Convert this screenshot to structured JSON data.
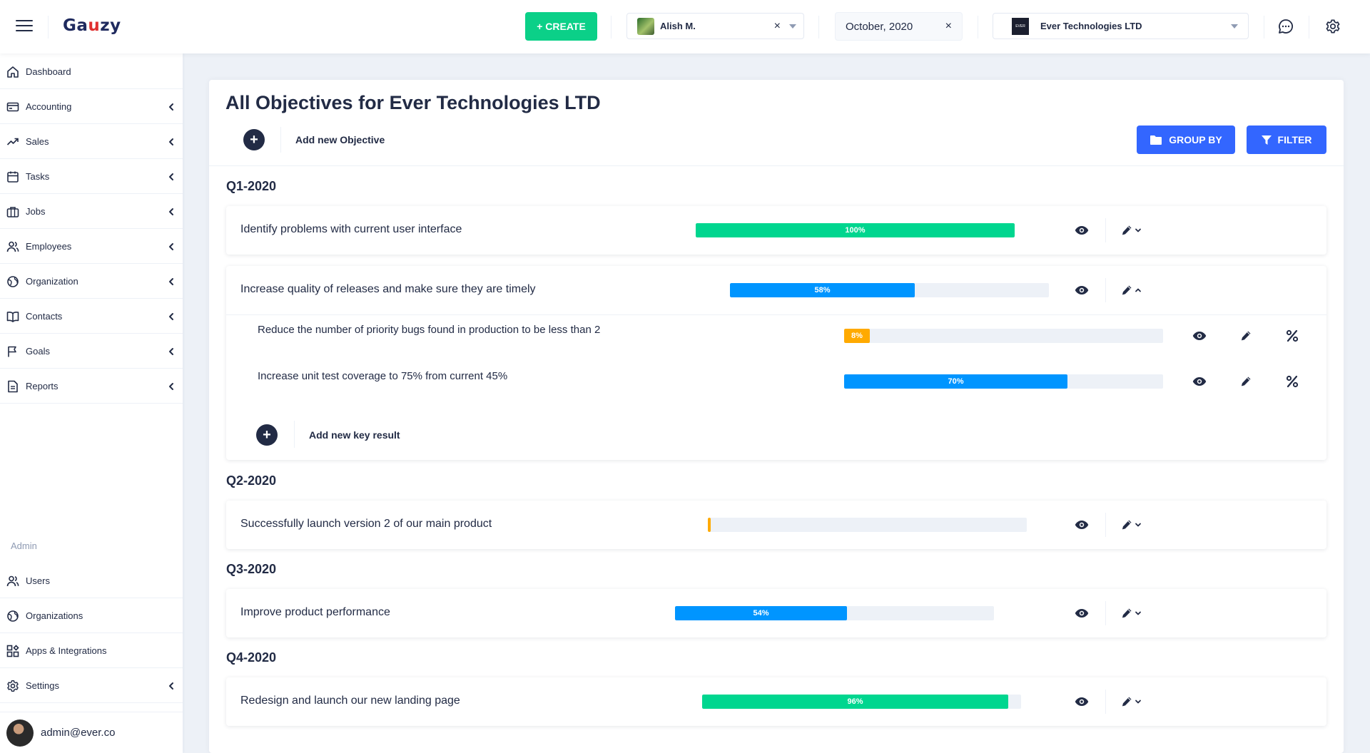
{
  "header": {
    "logo": {
      "pre": "Ga",
      "mid": "u",
      "post": "zy"
    },
    "create_label": "+ CREATE",
    "user": "Alish M.",
    "clear_symbol": "×",
    "date": "October, 2020",
    "organization": "Ever Technologies LTD",
    "org_logo_text": "EVER",
    "icons": [
      "menu-icon",
      "chat-icon",
      "settings-icon"
    ]
  },
  "sidebar": {
    "items": [
      {
        "label": "Dashboard",
        "icon": "home-icon",
        "chevron": false
      },
      {
        "label": "Accounting",
        "icon": "credit-card-icon",
        "chevron": true
      },
      {
        "label": "Sales",
        "icon": "trending-up-icon",
        "chevron": true
      },
      {
        "label": "Tasks",
        "icon": "calendar-icon",
        "chevron": true
      },
      {
        "label": "Jobs",
        "icon": "briefcase-icon",
        "chevron": true
      },
      {
        "label": "Employees",
        "icon": "people-icon",
        "chevron": true
      },
      {
        "label": "Organization",
        "icon": "globe-icon",
        "chevron": true
      },
      {
        "label": "Contacts",
        "icon": "book-icon",
        "chevron": true
      },
      {
        "label": "Goals",
        "icon": "flag-icon",
        "chevron": true
      },
      {
        "label": "Reports",
        "icon": "file-icon",
        "chevron": true
      }
    ],
    "admin_label": "Admin",
    "admin_items": [
      {
        "label": "Users",
        "icon": "people-icon",
        "chevron": false
      },
      {
        "label": "Organizations",
        "icon": "globe-icon",
        "chevron": false
      },
      {
        "label": "Apps & Integrations",
        "icon": "apps-icon",
        "chevron": false
      },
      {
        "label": "Settings",
        "icon": "settings-icon",
        "chevron": true
      }
    ],
    "profile_email": "admin@ever.co"
  },
  "main": {
    "title": "All Objectives for Ever Technologies LTD",
    "add_objective": "Add new Objective",
    "group_by": "GROUP BY",
    "filter": "FILTER",
    "add_key_result": "Add new key result",
    "quarters": [
      "Q1-2020",
      "Q2-2020",
      "Q3-2020",
      "Q4-2020"
    ],
    "objectives": [
      {
        "title": "Identify problems with current user interface",
        "progress": 100,
        "progress_label": "100%",
        "color": "#00d68f",
        "expanded": false
      },
      {
        "title": "Increase quality of releases and make sure they are timely",
        "progress": 58,
        "progress_label": "58%",
        "color": "#0095ff",
        "expanded": true
      },
      {
        "title": "Successfully launch version 2 of our main product",
        "progress": 1,
        "progress_label": "",
        "color": "#ffaa00",
        "expanded": false
      },
      {
        "title": "Improve product performance",
        "progress": 54,
        "progress_label": "54%",
        "color": "#0095ff",
        "expanded": false
      },
      {
        "title": "Redesign and launch our new landing page",
        "progress": 96,
        "progress_label": "96%",
        "color": "#00d68f",
        "expanded": false
      }
    ],
    "key_results": [
      {
        "title": "Reduce the number of priority bugs found in production to be less than 2",
        "progress": 8,
        "progress_label": "8%",
        "color": "#ffaa00"
      },
      {
        "title": "Increase unit test coverage to 75% from current 45%",
        "progress": 70,
        "progress_label": "70%",
        "color": "#0095ff"
      }
    ]
  },
  "colors": {
    "accent": "#3366ff",
    "success": "#00d68f",
    "info": "#0095ff",
    "warning": "#ffaa00",
    "create": "#0bd088",
    "text": "#222b45"
  }
}
